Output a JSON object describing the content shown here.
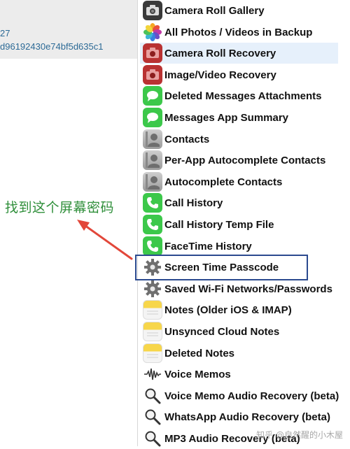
{
  "left_panel": {
    "line1": "27",
    "line2": "d96192430e74bf5d635c1"
  },
  "annotation": "找到这个屏幕密码",
  "menu": {
    "items": [
      {
        "label": "Camera Roll Gallery",
        "icon": "camera-icon"
      },
      {
        "label": "All Photos / Videos in Backup",
        "icon": "photos-icon"
      },
      {
        "label": "Camera Roll Recovery",
        "icon": "camera-recovery-icon"
      },
      {
        "label": "Image/Video Recovery",
        "icon": "camera-recovery-icon"
      },
      {
        "label": "Deleted Messages Attachments",
        "icon": "messages-icon"
      },
      {
        "label": "Messages App Summary",
        "icon": "messages-icon"
      },
      {
        "label": "Contacts",
        "icon": "contacts-icon"
      },
      {
        "label": "Per-App Autocomplete Contacts",
        "icon": "contacts-icon"
      },
      {
        "label": "Autocomplete Contacts",
        "icon": "contacts-icon"
      },
      {
        "label": "Call History",
        "icon": "phone-icon"
      },
      {
        "label": "Call History Temp File",
        "icon": "phone-icon"
      },
      {
        "label": "FaceTime History",
        "icon": "phone-icon"
      },
      {
        "label": "Screen Time Passcode",
        "icon": "gear-icon"
      },
      {
        "label": "Saved Wi-Fi Networks/Passwords",
        "icon": "gear-icon"
      },
      {
        "label": "Notes (Older iOS & IMAP)",
        "icon": "notes-icon"
      },
      {
        "label": "Unsynced Cloud Notes",
        "icon": "notes-icon"
      },
      {
        "label": "Deleted Notes",
        "icon": "notes-icon"
      },
      {
        "label": "Voice Memos",
        "icon": "waveform-icon"
      },
      {
        "label": "Voice Memo Audio Recovery (beta)",
        "icon": "magnifier-icon"
      },
      {
        "label": "WhatsApp Audio Recovery (beta)",
        "icon": "magnifier-icon"
      },
      {
        "label": "MP3 Audio Recovery (beta)",
        "icon": "magnifier-icon"
      }
    ],
    "selected_index": 2,
    "highlighted_index": 12
  },
  "watermark": "知乎 @自然醒的小木屋",
  "colors": {
    "annotation": "#2f8f3a",
    "arrow": "#e2473a",
    "highlight_border": "#2b4a8f",
    "selected_bg": "#e6f0fb",
    "id_text": "#2c6a96"
  }
}
